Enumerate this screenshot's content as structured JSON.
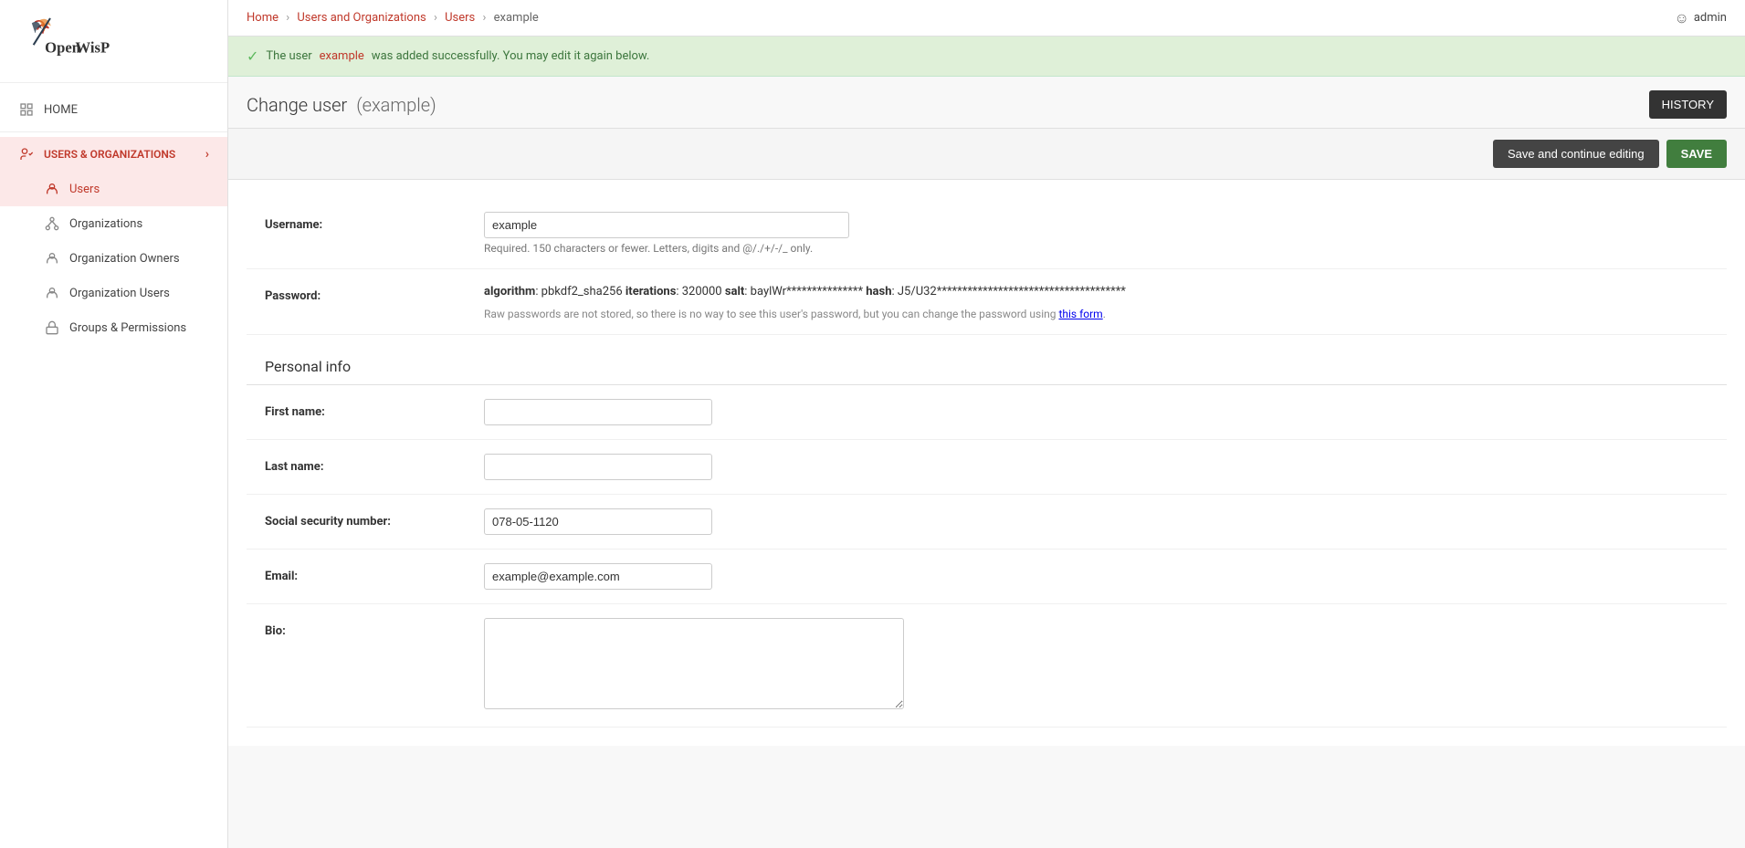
{
  "app": {
    "logo_text": "OpenWISP"
  },
  "topbar": {
    "breadcrumb": {
      "home": "Home",
      "section": "Users and Organizations",
      "subsection": "Users",
      "current": "example"
    },
    "user": "admin"
  },
  "success_message": {
    "prefix": "The user ",
    "username": "example",
    "suffix": " was added successfully. You may edit it again below."
  },
  "page": {
    "title": "Change user",
    "subtitle": "(example)",
    "history_btn": "HISTORY"
  },
  "actions": {
    "save_continue": "Save and continue editing",
    "save": "SAVE"
  },
  "sidebar": {
    "home": "HOME",
    "users_orgs": {
      "label": "USERS & ORGANIZATIONS",
      "chevron": "›",
      "items": [
        {
          "label": "Users",
          "active": true
        },
        {
          "label": "Organizations",
          "active": false
        },
        {
          "label": "Organization Owners",
          "active": false
        },
        {
          "label": "Organization Users",
          "active": false
        },
        {
          "label": "Groups & Permissions",
          "active": false
        }
      ]
    }
  },
  "form": {
    "username": {
      "label": "Username:",
      "value": "example",
      "help": "Required. 150 characters or fewer. Letters, digits and @/./+/-/_ only."
    },
    "password": {
      "label": "Password:",
      "algorithm_label": "algorithm",
      "algorithm_value": "pbkdf2_sha256",
      "iterations_label": "iterations",
      "iterations_value": "320000",
      "salt_label": "salt",
      "salt_value": "baylWr***************",
      "hash_label": "hash",
      "hash_value": "J5/U32*************************************",
      "help": "Raw passwords are not stored, so there is no way to see this user's password, but you can change the password using ",
      "link_text": "this form"
    },
    "personal_info": {
      "section_title": "Personal info",
      "first_name": {
        "label": "First name:",
        "value": ""
      },
      "last_name": {
        "label": "Last name:",
        "value": ""
      },
      "ssn": {
        "label": "Social security number:",
        "value": "078-05-1120"
      },
      "email": {
        "label": "Email:",
        "value": "example@example.com"
      },
      "bio": {
        "label": "Bio:",
        "value": ""
      }
    }
  }
}
